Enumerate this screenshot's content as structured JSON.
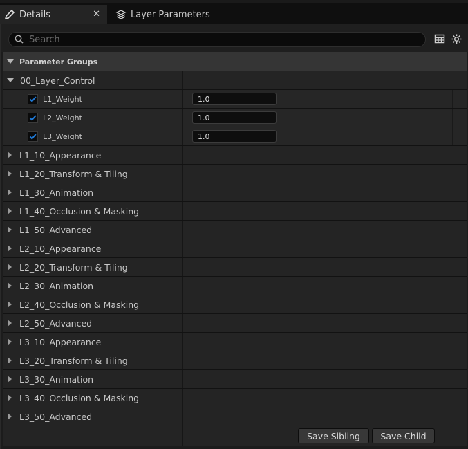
{
  "tabs": [
    {
      "label": "Details",
      "icon": "pencil-icon",
      "active": true
    },
    {
      "label": "Layer Parameters",
      "icon": "layers-icon",
      "active": false
    }
  ],
  "search": {
    "placeholder": "Search",
    "value": ""
  },
  "toolbar": {
    "table_icon": "table-icon",
    "settings_icon": "gear-icon"
  },
  "groups_header": {
    "label": "Parameter Groups"
  },
  "layer_control": {
    "label": "00_Layer_Control",
    "params": [
      {
        "label": "L1_Weight",
        "checked": true,
        "value": "1.0"
      },
      {
        "label": "L2_Weight",
        "checked": true,
        "value": "1.0"
      },
      {
        "label": "L3_Weight",
        "checked": true,
        "value": "1.0"
      }
    ]
  },
  "groups": [
    "L1_10_Appearance",
    "L1_20_Transform & Tiling",
    "L1_30_Animation",
    "L1_40_Occlusion & Masking",
    "L1_50_Advanced",
    "L2_10_Appearance",
    "L2_20_Transform & Tiling",
    "L2_30_Animation",
    "L2_40_Occlusion & Masking",
    "L2_50_Advanced",
    "L3_10_Appearance",
    "L3_20_Transform & Tiling",
    "L3_30_Animation",
    "L3_40_Occlusion & Masking",
    "L3_50_Advanced"
  ],
  "footer": {
    "save_sibling": "Save Sibling",
    "save_child": "Save Child"
  },
  "colors": {
    "checkbox_tick": "#1f7ad8",
    "background": "#1c1c1c",
    "row": "#242424"
  }
}
